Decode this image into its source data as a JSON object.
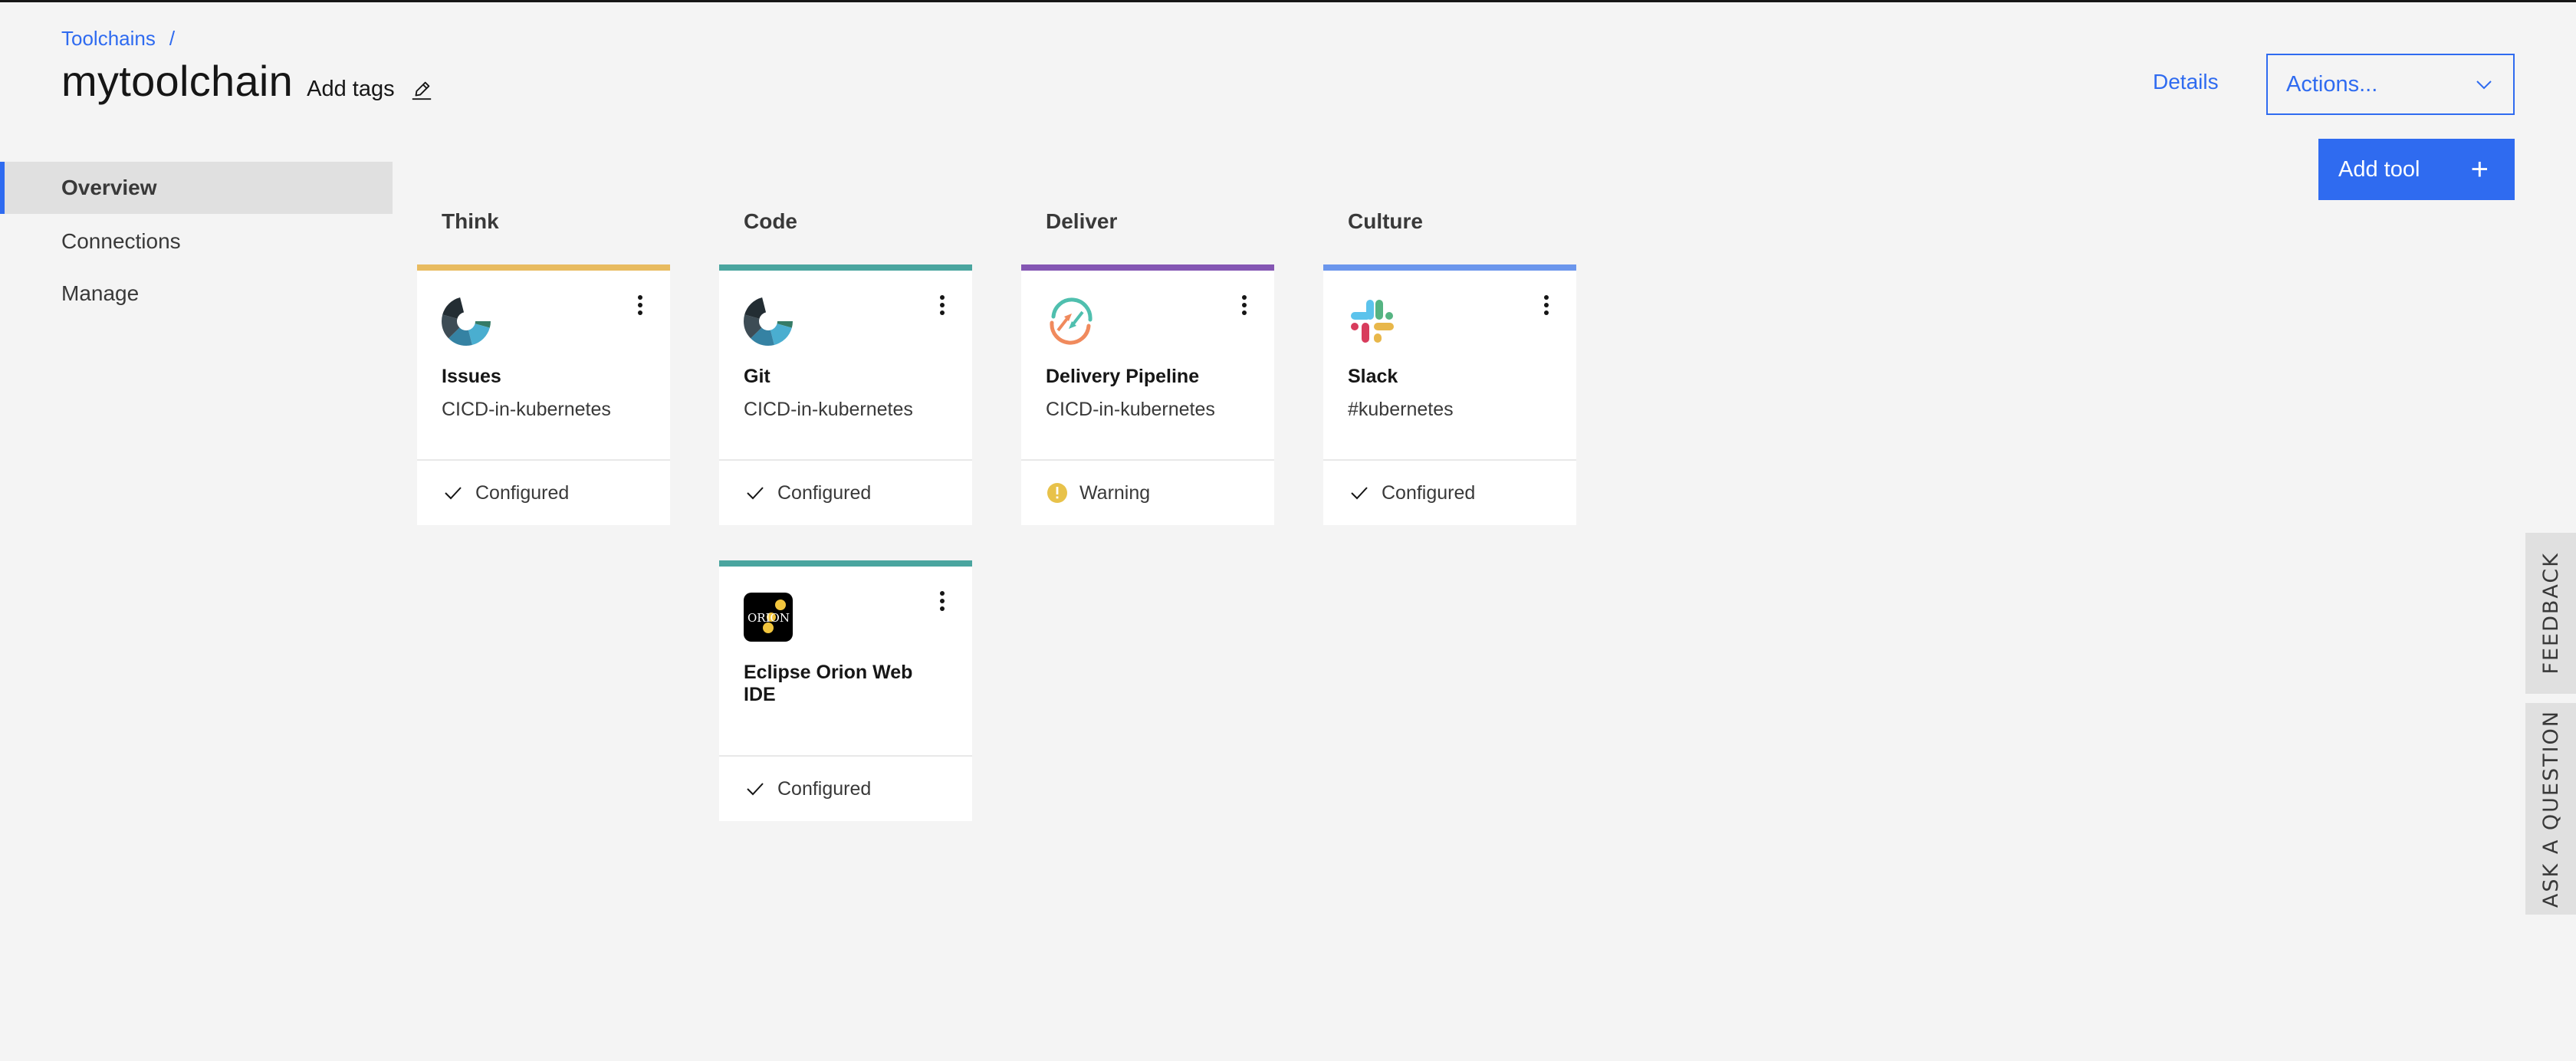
{
  "breadcrumb": {
    "items": [
      "Toolchains"
    ],
    "separator": "/"
  },
  "header": {
    "title": "mytoolchain",
    "add_tags_label": "Add tags",
    "details_label": "Details",
    "actions_label": "Actions...",
    "add_tool_label": "Add tool",
    "add_tool_icon": "+"
  },
  "sidebar": {
    "items": [
      {
        "label": "Overview",
        "active": true
      },
      {
        "label": "Connections",
        "active": false
      },
      {
        "label": "Manage",
        "active": false
      }
    ]
  },
  "columns": [
    {
      "title": "Think",
      "color": "#e8bb60"
    },
    {
      "title": "Code",
      "color": "#4aa59f"
    },
    {
      "title": "Deliver",
      "color": "#8456b3"
    },
    {
      "title": "Culture",
      "color": "#6b96ec"
    }
  ],
  "tools": [
    {
      "column": "Think",
      "name": "Issues",
      "subtitle": "CICD-in-kubernetes",
      "icon": "git-donut-icon",
      "status": "Configured",
      "status_icon": "checkmark-icon"
    },
    {
      "column": "Code",
      "name": "Git",
      "subtitle": "CICD-in-kubernetes",
      "icon": "git-donut-icon",
      "status": "Configured",
      "status_icon": "checkmark-icon"
    },
    {
      "column": "Deliver",
      "name": "Delivery Pipeline",
      "subtitle": "CICD-in-kubernetes",
      "icon": "pipeline-arrows-icon",
      "status": "Warning",
      "status_icon": "warning-icon"
    },
    {
      "column": "Culture",
      "name": "Slack",
      "subtitle": "#kubernetes",
      "icon": "slack-icon",
      "status": "Configured",
      "status_icon": "checkmark-icon"
    },
    {
      "column": "Code",
      "name": "Eclipse Orion Web IDE",
      "subtitle": "",
      "icon": "orion-icon",
      "status": "Configured",
      "status_icon": "checkmark-icon"
    }
  ],
  "orion_logo_text": "ORION",
  "side_tabs": {
    "feedback": "FEEDBACK",
    "ask": "ASK A QUESTION"
  },
  "colors": {
    "accent": "#2f6bf0",
    "warning": "#f1c21b"
  }
}
